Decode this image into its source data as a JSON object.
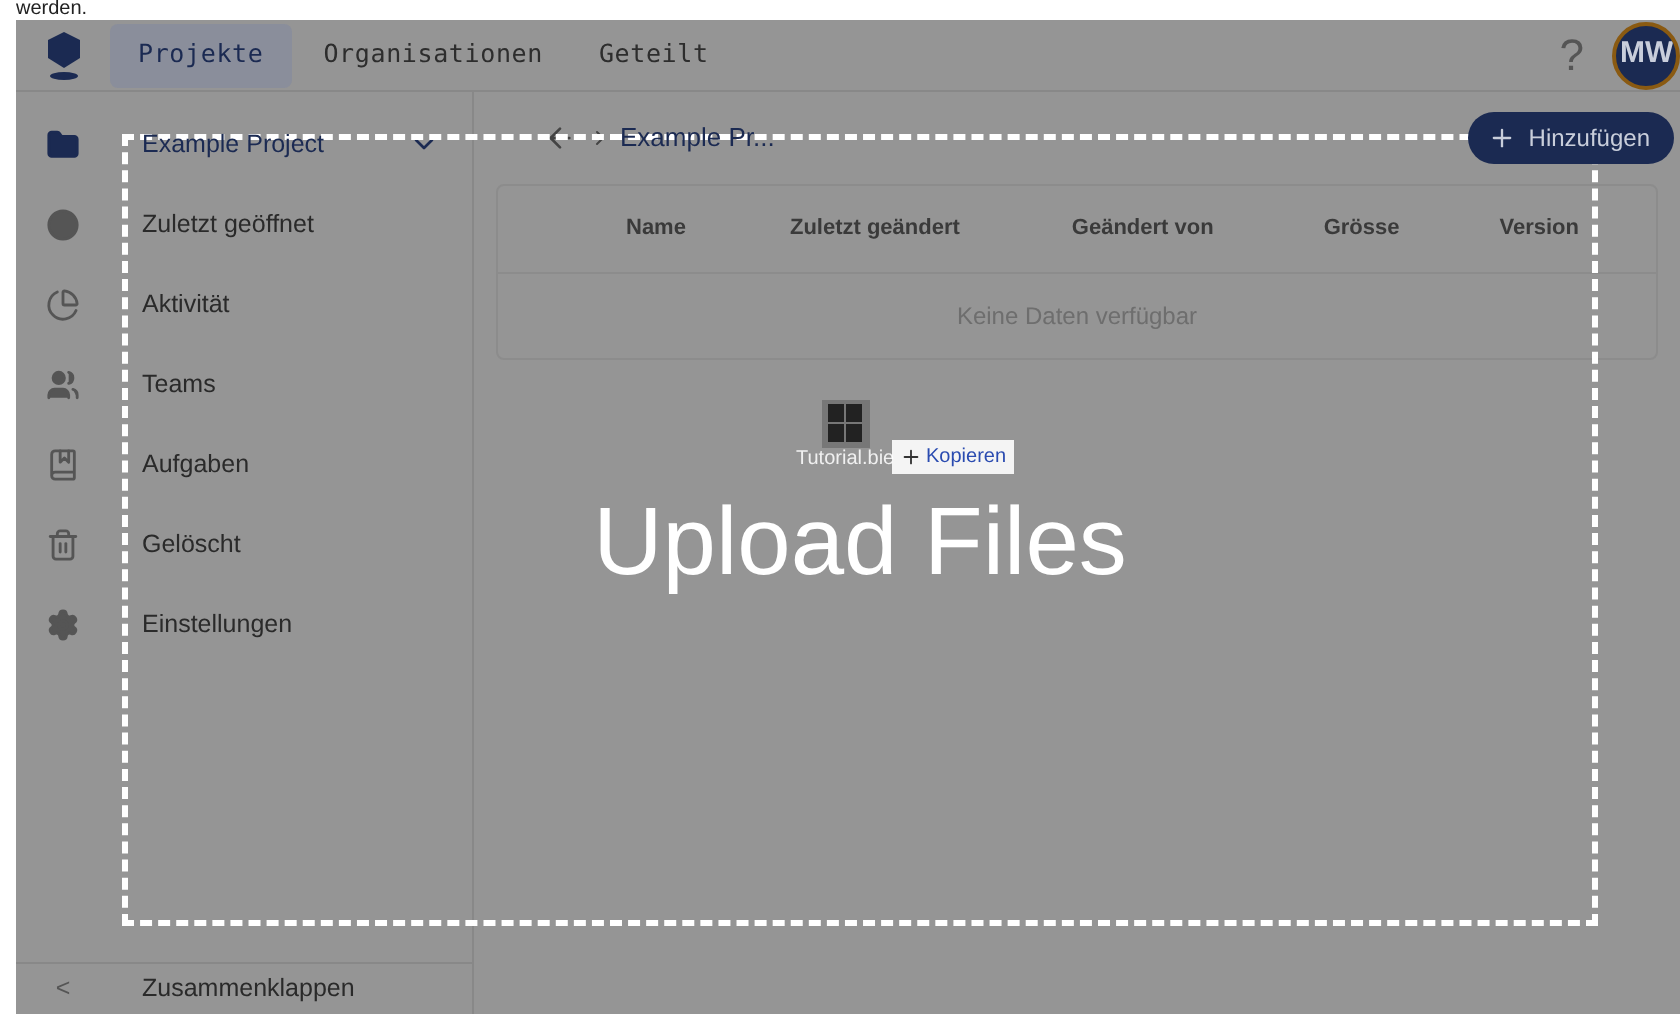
{
  "top_text": "werden.",
  "header": {
    "tabs": [
      {
        "label": "Projekte",
        "selected": true
      },
      {
        "label": "Organisationen",
        "selected": false
      },
      {
        "label": "Geteilt",
        "selected": false
      }
    ],
    "help": "?",
    "avatar": "MW"
  },
  "nav": {
    "items": [
      {
        "label": "Example Project",
        "selected": true,
        "expandable": true
      },
      {
        "label": "Zuletzt geöffnet",
        "selected": false,
        "expandable": false
      },
      {
        "label": "Aktivität",
        "selected": false,
        "expandable": false
      },
      {
        "label": "Teams",
        "selected": false,
        "expandable": false
      },
      {
        "label": "Aufgaben",
        "selected": false,
        "expandable": false
      },
      {
        "label": "Gelöscht",
        "selected": false,
        "expandable": false
      },
      {
        "label": "Einstellungen",
        "selected": false,
        "expandable": false
      }
    ],
    "collapse": {
      "icon": "<",
      "label": "Zusammenklappen"
    }
  },
  "breadcrumb": "Example Pr...",
  "add_button": "Hinzufügen",
  "table": {
    "columns": [
      "Name",
      "Zuletzt geändert",
      "Geändert von",
      "Grösse",
      "Version"
    ],
    "empty": "Keine Daten verfügbar"
  },
  "drop_overlay": {
    "title": "Upload Files",
    "file_name": "Tutorial.bie",
    "action": "Kopieren"
  }
}
